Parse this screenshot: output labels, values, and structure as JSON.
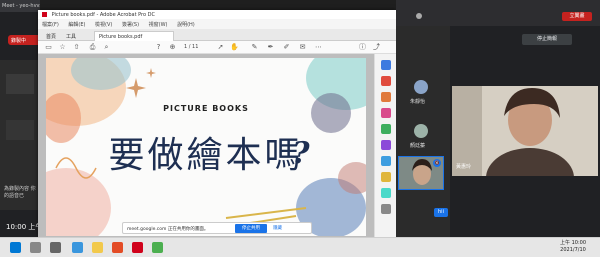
{
  "meet": {
    "tab_title": "Meet - yeo-hvvs-hw",
    "recording_label": "錄製中",
    "left_caption": "為錄製內容 你的語音已",
    "clock": "10:00 上午",
    "stop_present": "停止簡報",
    "participants": [
      {
        "name": "朱靜怡"
      },
      {
        "name": "顏廷蓁"
      }
    ],
    "camera_name": "黃惠玲",
    "small_cam_badge": "🔇",
    "hii_badge": "hii",
    "win_top_badge": "立翼畫"
  },
  "acrobat": {
    "title": "Picture books.pdf - Adobe Acrobat Pro DC",
    "menu": [
      "檔案(F)",
      "編輯(E)",
      "檢視(V)",
      "簽署(S)",
      "視窗(W)",
      "說明(H)"
    ],
    "tabs": {
      "home": "首頁",
      "tools": "工具",
      "doc": "Picture books.pdf"
    },
    "page_indicator": "1 / 11",
    "slide_small_title": "PICTURE BOOKS",
    "slide_main_title": "要做繪本嗎",
    "slide_qmark": "?"
  },
  "share_bar": {
    "text": "meet.google.com 正在共用你的畫面。",
    "stop_label": "停止共用",
    "hide_label": "隱藏"
  },
  "taskbar": {
    "time": "上午 10:00",
    "date": "2021/7/10"
  },
  "colors": {
    "title_navy": "#1e2f52",
    "rec_red": "#c5221f",
    "meet_blue": "#1a73e8"
  }
}
